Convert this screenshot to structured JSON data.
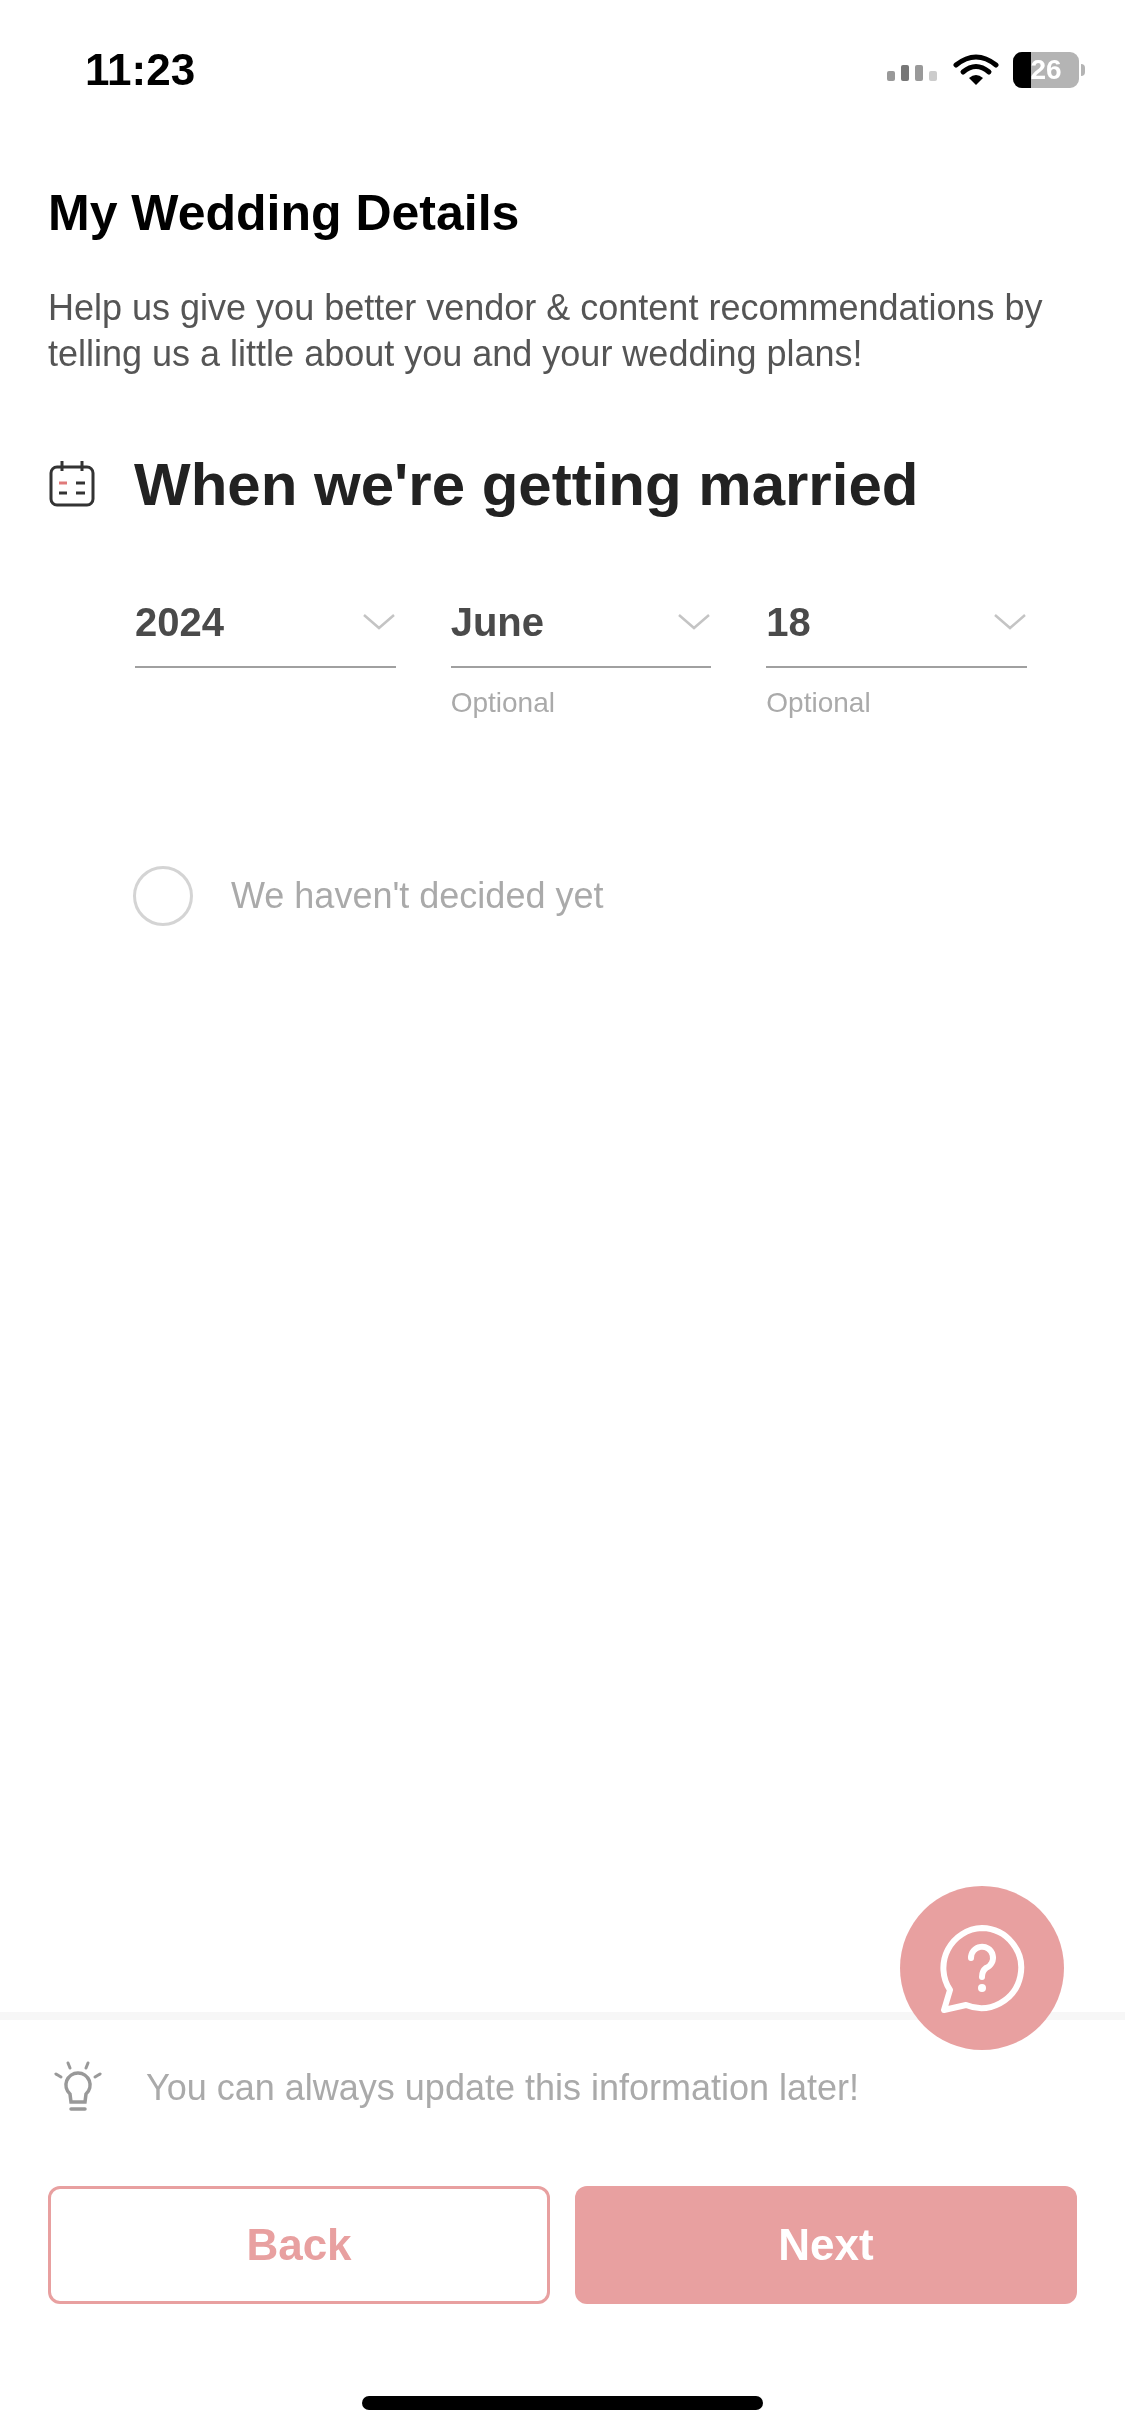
{
  "status_bar": {
    "time": "11:23",
    "battery": "26"
  },
  "header": {
    "title": "My Wedding Details",
    "description": "Help us give you better vendor & content recommendations by telling us a little about you and your wedding plans!"
  },
  "section": {
    "title": "When we're getting married",
    "dropdowns": [
      {
        "value": "2024"
      },
      {
        "value": "June",
        "hint": "Optional"
      },
      {
        "value": "18",
        "hint": "Optional"
      }
    ],
    "undecided": {
      "label": "We haven't decided yet",
      "selected": false
    }
  },
  "tip": "You can always update this information later!",
  "buttons": [
    {
      "label": "Back",
      "kind": "outline"
    },
    {
      "label": "Next",
      "kind": "filled"
    }
  ]
}
